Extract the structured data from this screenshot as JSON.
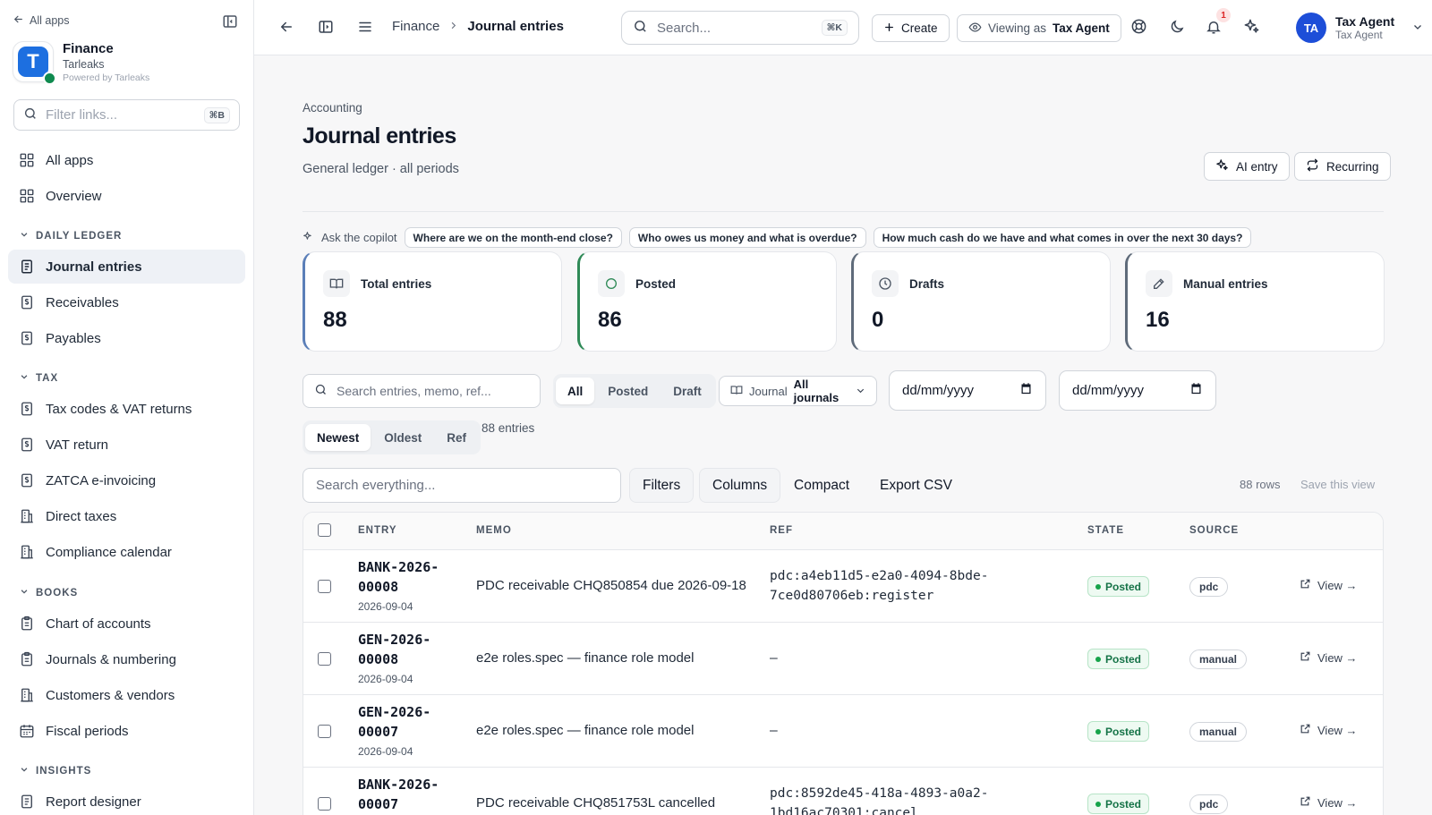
{
  "sidebar": {
    "back_label": "All apps",
    "brand": {
      "title": "Finance",
      "subtitle": "Tarleaks",
      "powered": "Powered by Tarleaks",
      "logo_letter": "T"
    },
    "filter": {
      "placeholder": "Filter links...",
      "shortcut": "⌘B"
    },
    "top_items": [
      {
        "label": "All apps"
      },
      {
        "label": "Overview"
      }
    ],
    "sections": [
      {
        "title": "DAILY LEDGER",
        "items": [
          {
            "label": "Journal entries",
            "active": true
          },
          {
            "label": "Receivables"
          },
          {
            "label": "Payables"
          }
        ]
      },
      {
        "title": "TAX",
        "items": [
          {
            "label": "Tax codes & VAT returns"
          },
          {
            "label": "VAT return"
          },
          {
            "label": "ZATCA e-invoicing"
          },
          {
            "label": "Direct taxes"
          },
          {
            "label": "Compliance calendar"
          }
        ]
      },
      {
        "title": "BOOKS",
        "items": [
          {
            "label": "Chart of accounts"
          },
          {
            "label": "Journals & numbering"
          },
          {
            "label": "Customers & vendors"
          },
          {
            "label": "Fiscal periods"
          }
        ]
      },
      {
        "title": "INSIGHTS",
        "items": [
          {
            "label": "Report designer"
          }
        ]
      }
    ]
  },
  "topbar": {
    "breadcrumb": [
      "Finance",
      "Journal entries"
    ],
    "search": {
      "placeholder": "Search...",
      "shortcut": "⌘K"
    },
    "create_label": "Create",
    "viewing": {
      "label": "Viewing as",
      "value": "Tax Agent"
    },
    "notification_count": "1",
    "user": {
      "initials": "TA",
      "name": "Tax Agent",
      "role": "Tax Agent"
    }
  },
  "page": {
    "eyebrow": "Accounting",
    "title": "Journal entries",
    "subtitle": "General ledger · all periods",
    "ai_entry_label": "AI entry",
    "recurring_label": "Recurring"
  },
  "copilot": {
    "label": "Ask the copilot",
    "suggestions": [
      "Where are we on the month-end close?",
      "Who owes us money and what is overdue?",
      "How much cash do we have and what comes in over the next 30 days?"
    ]
  },
  "stats": [
    {
      "label": "Total entries",
      "value": "88",
      "accent": "#5b7fb8"
    },
    {
      "label": "Posted",
      "value": "86",
      "accent": "#2f8a57"
    },
    {
      "label": "Drafts",
      "value": "0",
      "accent": "#5f6b7a"
    },
    {
      "label": "Manual entries",
      "value": "16",
      "accent": "#5f6b7a"
    }
  ],
  "filters": {
    "search_placeholder": "Search entries, memo, ref...",
    "status_options": [
      "All",
      "Posted",
      "Draft"
    ],
    "status_selected": "All",
    "journal": {
      "label": "Journal",
      "value": "All journals"
    },
    "date_from": "dd/mm/yyyy",
    "date_to": "dd/mm/yyyy",
    "sort_options": [
      "Newest",
      "Oldest",
      "Ref"
    ],
    "sort_selected": "Newest",
    "entries_count": "88 entries"
  },
  "table_tools": {
    "search_placeholder": "Search everything...",
    "filters_label": "Filters",
    "columns_label": "Columns",
    "compact_label": "Compact",
    "export_label": "Export CSV",
    "rows_count": "88 rows",
    "save_view_label": "Save this view"
  },
  "table": {
    "headers": [
      "ENTRY",
      "MEMO",
      "REF",
      "STATE",
      "SOURCE"
    ],
    "view_label": "View →",
    "rows": [
      {
        "entry": "BANK-2026-00008",
        "entry_l1": "BANK-2026-",
        "entry_l2": "00008",
        "date": "2026-09-04",
        "memo": "PDC receivable CHQ850854 due 2026-09-18",
        "ref_l1": "pdc:a4eb11d5-e2a0-4094-8bde-",
        "ref_l2": "7ce0d80706eb:register",
        "state": "Posted",
        "source": "pdc"
      },
      {
        "entry": "GEN-2026-00008",
        "entry_l1": "GEN-2026-",
        "entry_l2": "00008",
        "date": "2026-09-04",
        "memo": "e2e roles.spec — finance role model",
        "ref_l1": "–",
        "ref_l2": "",
        "state": "Posted",
        "source": "manual"
      },
      {
        "entry": "GEN-2026-00007",
        "entry_l1": "GEN-2026-",
        "entry_l2": "00007",
        "date": "2026-09-04",
        "memo": "e2e roles.spec — finance role model",
        "ref_l1": "–",
        "ref_l2": "",
        "state": "Posted",
        "source": "manual"
      },
      {
        "entry": "BANK-2026-00007",
        "entry_l1": "BANK-2026-",
        "entry_l2": "00007",
        "date": "",
        "memo": "PDC receivable CHQ851753L cancelled",
        "ref_l1": "pdc:8592de45-418a-4893-a0a2-",
        "ref_l2": "1bd16ac70301:cancel",
        "state": "Posted",
        "source": "pdc"
      }
    ]
  }
}
